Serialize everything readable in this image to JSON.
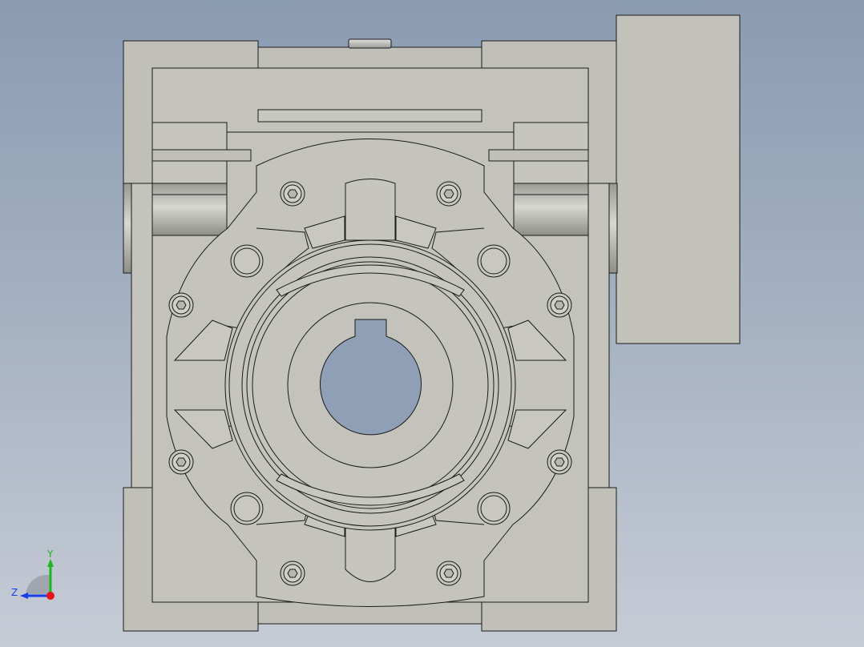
{
  "viewport": {
    "background_top": "#8a9bb2",
    "background_bottom": "#c6ccd6"
  },
  "model": {
    "part_fill": "#c0c0b8",
    "part_fill_light": "#cbcbc3",
    "shaded_fill": "#b4b4ac",
    "edge_color": "#1a1a1a"
  },
  "triad": {
    "x_axis_color": "#e8121b",
    "y_axis_color": "#1ab81a",
    "z_axis_color": "#1a3ee8",
    "y_label": "Y",
    "z_label": "Z"
  }
}
